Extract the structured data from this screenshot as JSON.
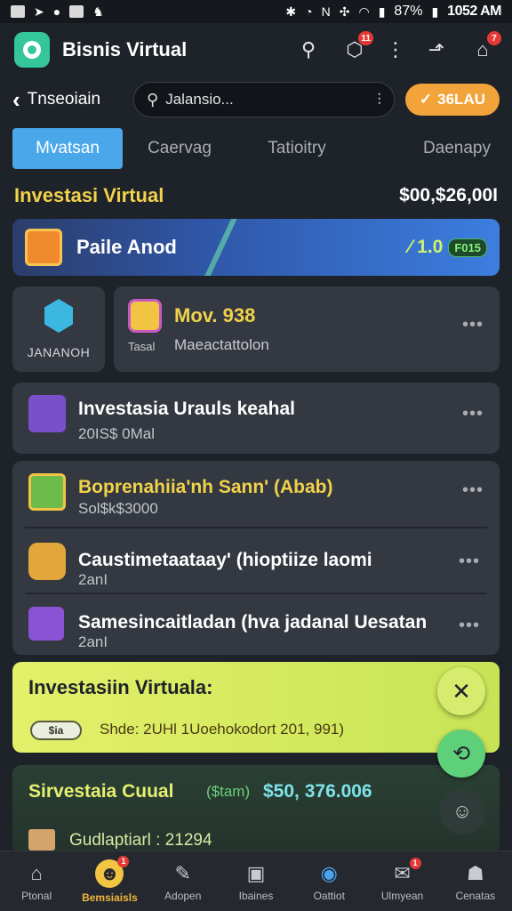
{
  "status_bar": {
    "battery": "87%",
    "time": "1052 AM",
    "icons": [
      "notification-icon",
      "telegram-icon",
      "app-icon",
      "gallery-icon",
      "cat-icon",
      "bluetooth-icon",
      "alarm-icon",
      "nfc-icon",
      "sync-icon",
      "wifi-icon",
      "signal-icon",
      "battery-icon"
    ]
  },
  "header": {
    "title": "Bisnis Virtual",
    "icons": [
      "search-icon",
      "box-icon",
      "share-icon",
      "storefront-icon"
    ],
    "box_badge": "11",
    "store_badge": "7",
    "logo_color": "#35c79a"
  },
  "toolbar": {
    "back_label": "Tnseoiain",
    "search_value": "Jalansio...",
    "sell_label": "36LAU"
  },
  "tabs": [
    "Mvatsan",
    "Caervag",
    "Tatioitry",
    "Daenapy"
  ],
  "section": {
    "title": "Investasi Virtual",
    "total": "$00,$26,00I"
  },
  "hero": {
    "title": "Paile Anod",
    "value": "1.0",
    "chip": "F015"
  },
  "mini_card": {
    "label": "JANANOH"
  },
  "wide_card": {
    "title": "Mov. 938",
    "tag": "Tasal",
    "subtitle": "Maeactattolon"
  },
  "items": [
    {
      "title": "Investasia Urauls keahal",
      "subtitle": "20IS$ 0Mal"
    },
    {
      "title": "Boprenahiia'nh Sann' (Abab)",
      "subtitle": "Sol$k$3000"
    },
    {
      "title": "Caustimetaataay' (hioptiize laomi",
      "subtitle": "2anI"
    },
    {
      "title": "Samesincaitladan (hva jadanal Uesatan",
      "subtitle": "2anI"
    }
  ],
  "banner": {
    "title": "Investasiin Virtuala:",
    "chip": "$ia",
    "text": "Shde: 2UHl 1Uoehokodort 201, 991)"
  },
  "green_card": {
    "title": "Sirvestaia Cuual",
    "tag": "($tam)",
    "value": "$50, 376.006",
    "subtitle": "Gudlaptiarl : 21294"
  },
  "nav": [
    {
      "label": "Ptonal",
      "icon": "home-icon"
    },
    {
      "label": "Bemsiaisls",
      "icon": "business-icon",
      "badge": "1"
    },
    {
      "label": "Adopen",
      "icon": "tools-icon"
    },
    {
      "label": "Ibaines",
      "icon": "briefcase-icon"
    },
    {
      "label": "Oattiot",
      "icon": "chat-icon"
    },
    {
      "label": "Ulmyean",
      "icon": "mail-icon",
      "badge": "1"
    },
    {
      "label": "Cenatas",
      "icon": "profile-icon"
    }
  ]
}
